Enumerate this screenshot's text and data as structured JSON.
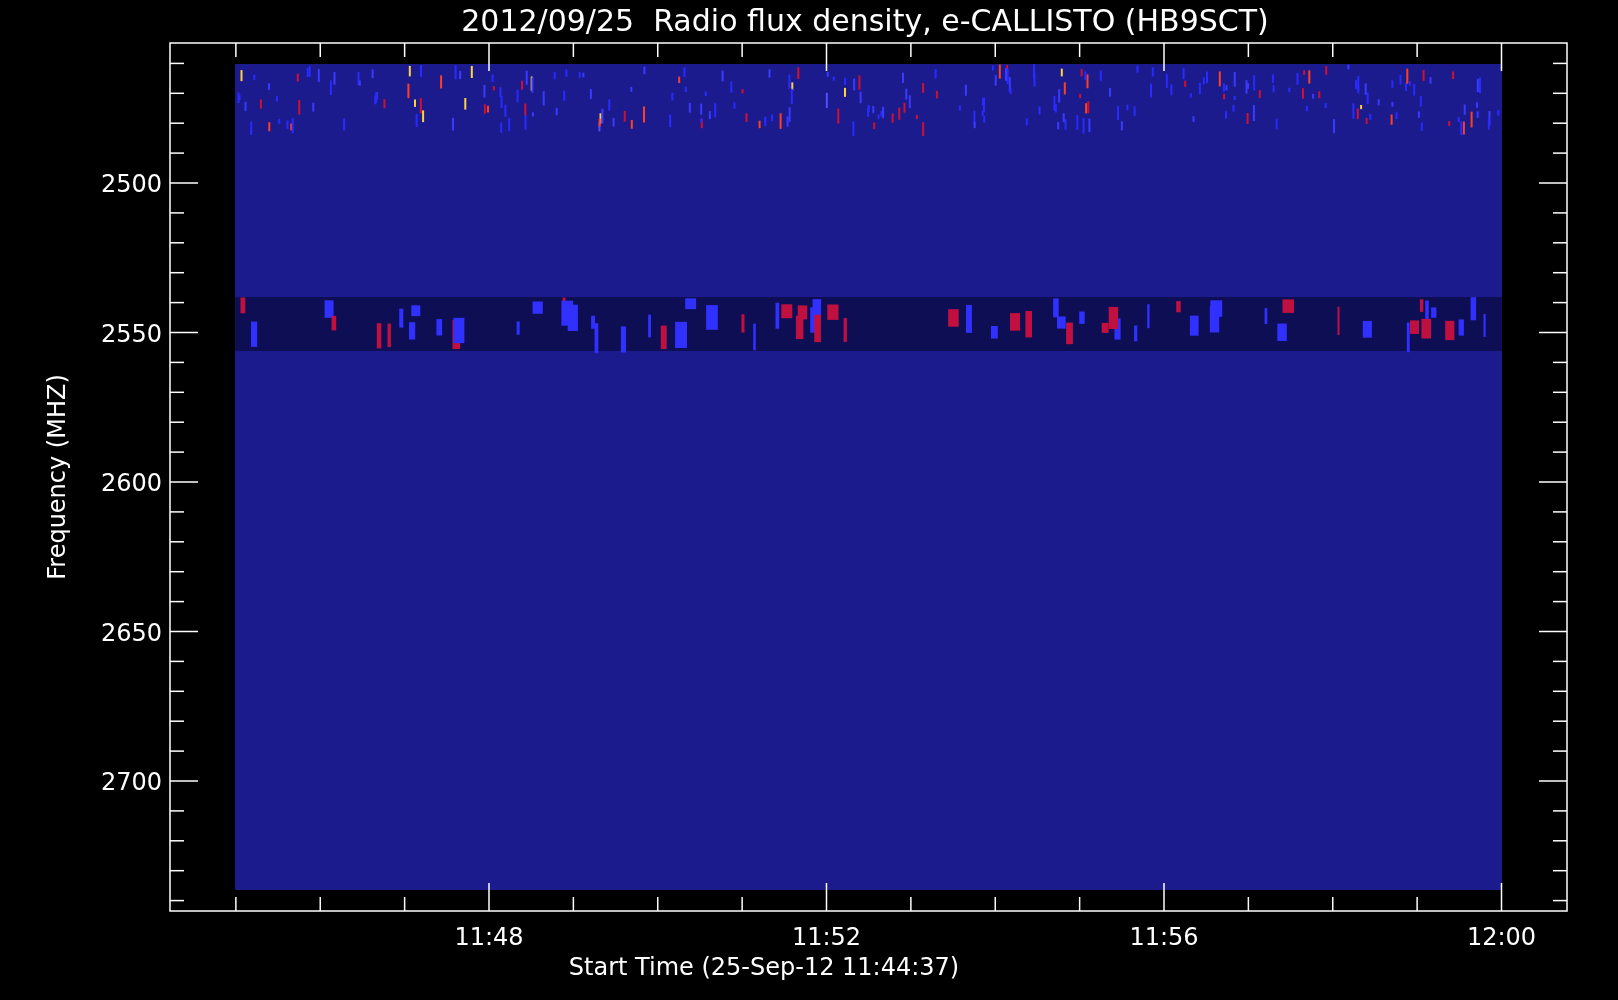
{
  "title": "2012/09/25  Radio flux density, e-CALLISTO (HB9SCT)",
  "x_axis": {
    "label": "Start Time (25-Sep-12 11:44:37)",
    "ticks": [
      "11:48",
      "11:52",
      "11:56",
      "12:00"
    ]
  },
  "y_axis": {
    "label": "Frequency (MHZ)",
    "ticks": [
      "2500",
      "2550",
      "2600",
      "2650",
      "2700"
    ]
  }
}
